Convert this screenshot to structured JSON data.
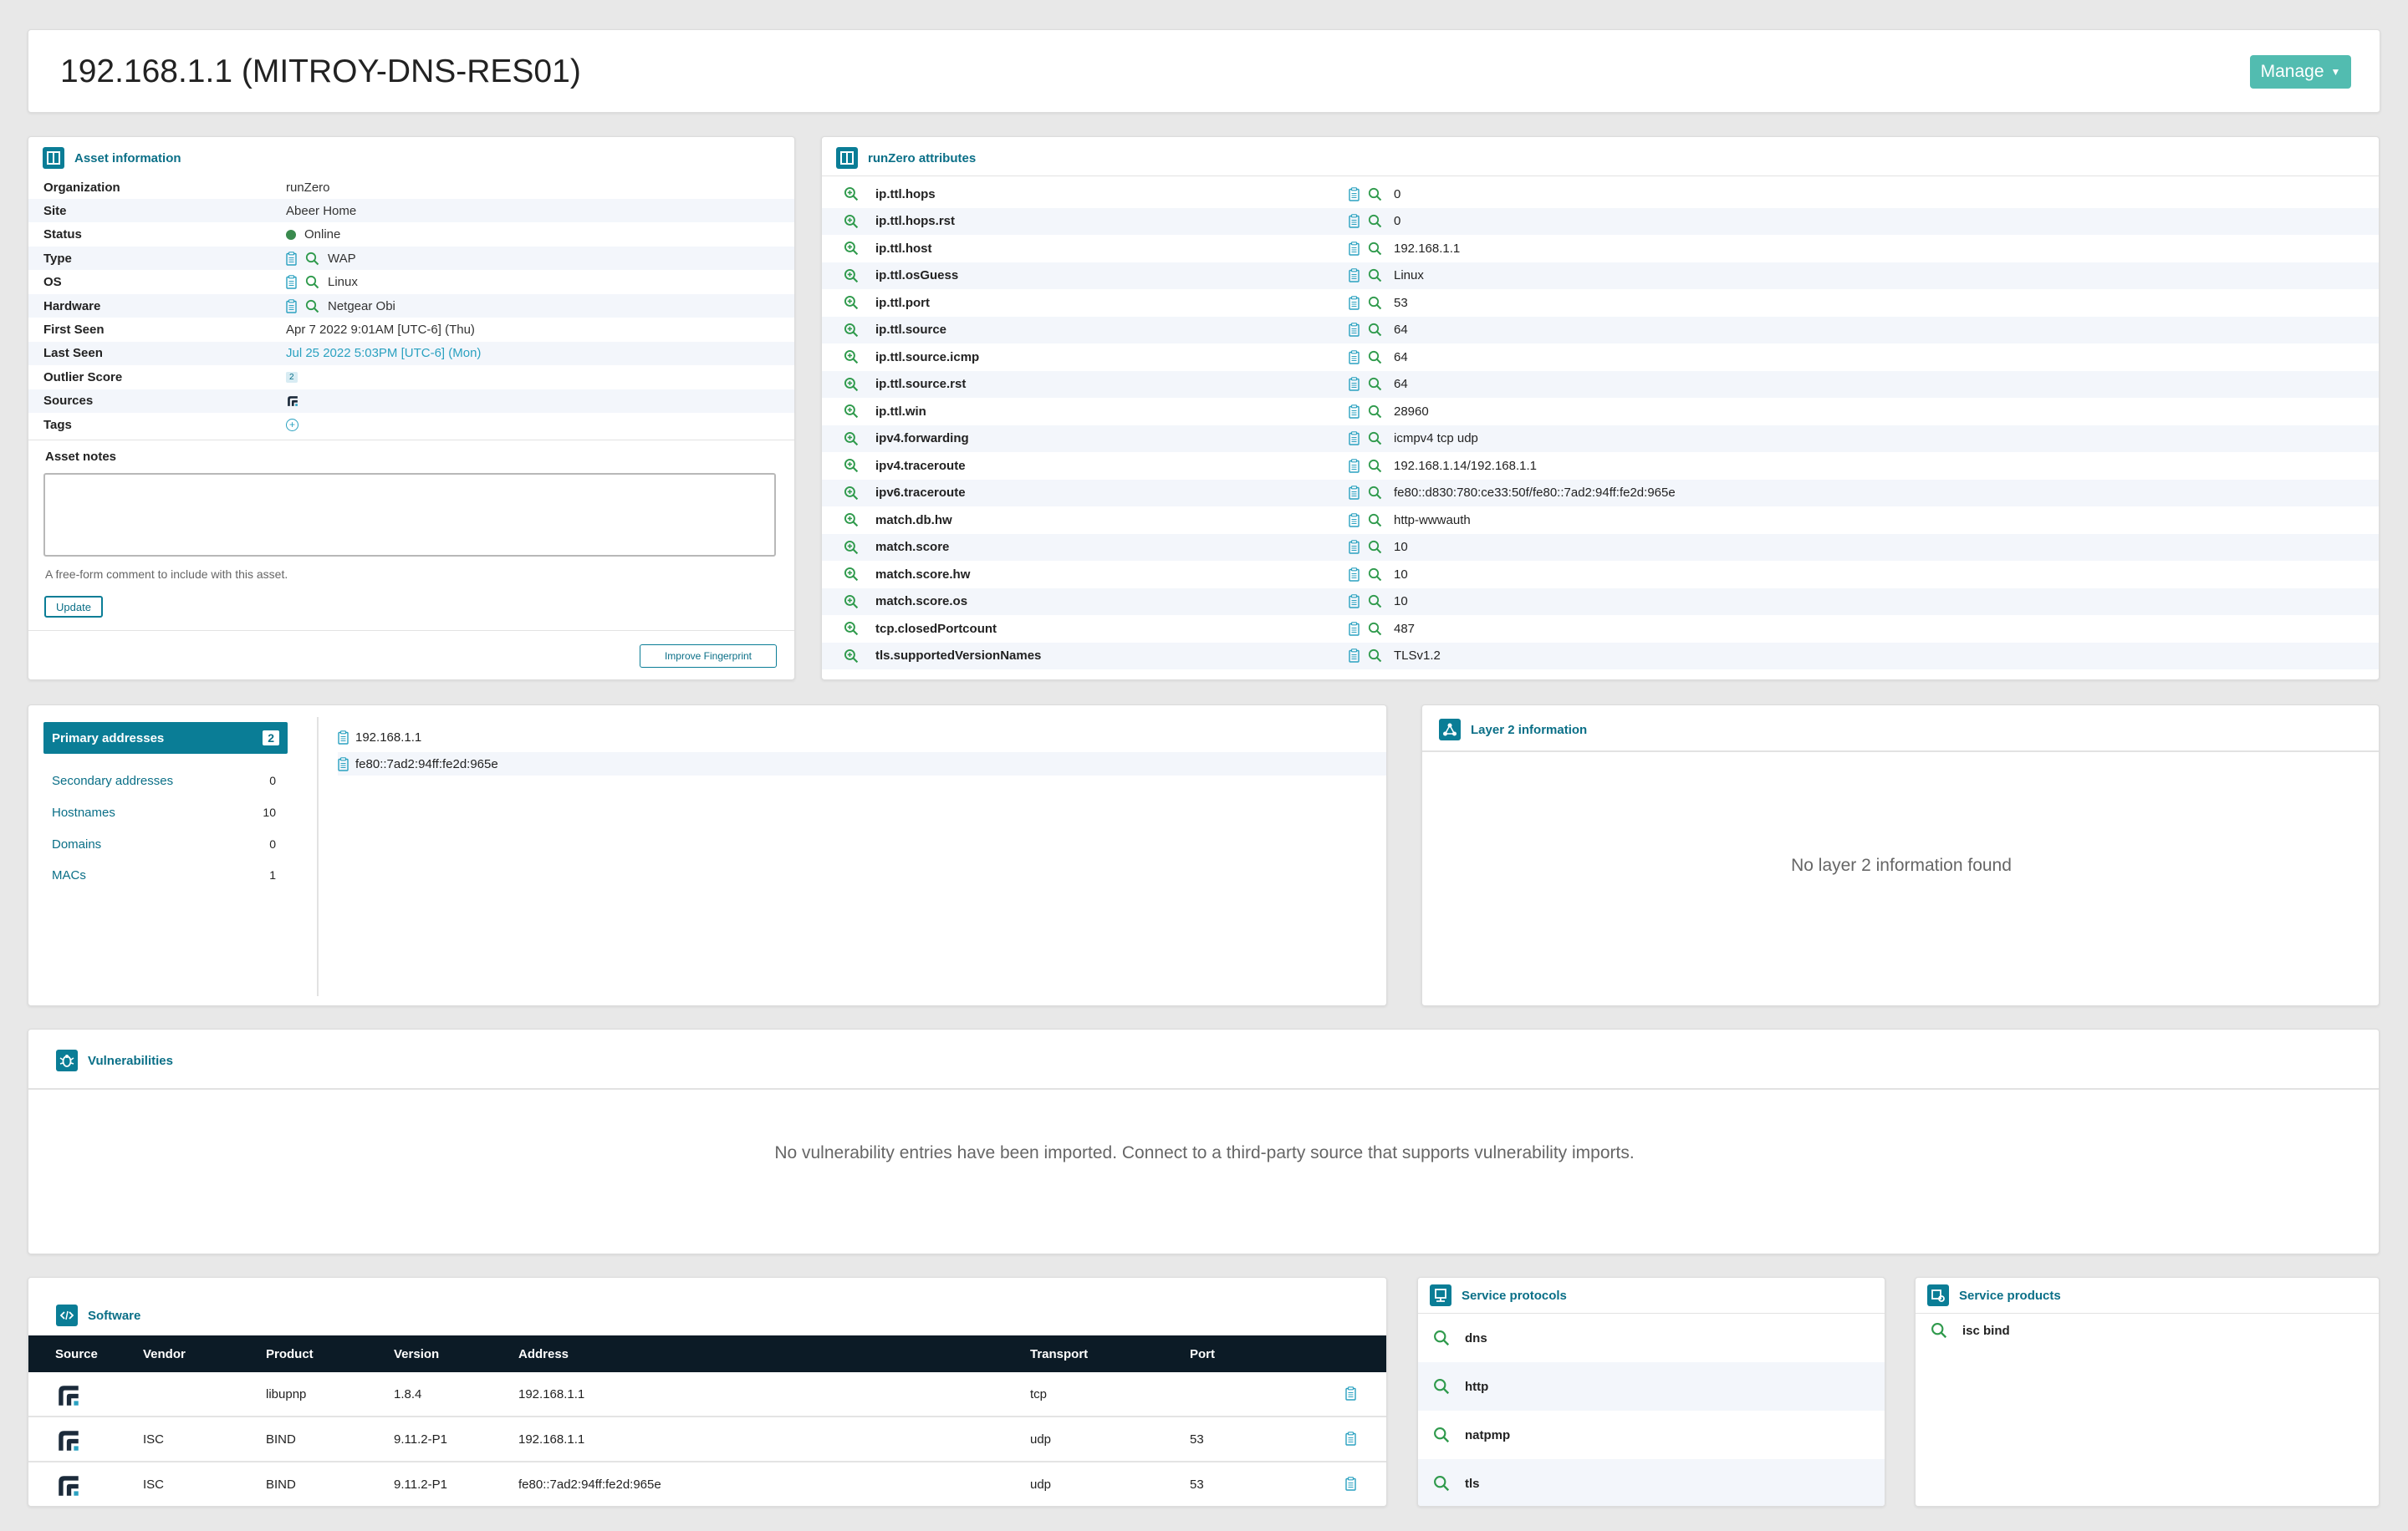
{
  "header": {
    "title": "192.168.1.1 (MITROY-DNS-RES01)",
    "manage_label": "Manage"
  },
  "asset_info": {
    "title": "Asset information",
    "rows": [
      {
        "key": "Organization",
        "value": "runZero"
      },
      {
        "key": "Site",
        "value": "Abeer Home"
      },
      {
        "key": "Status",
        "value": "Online"
      },
      {
        "key": "Type",
        "value": "WAP"
      },
      {
        "key": "OS",
        "value": "Linux"
      },
      {
        "key": "Hardware",
        "value": "Netgear Obi"
      },
      {
        "key": "First Seen",
        "value": "Apr 7 2022 9:01AM [UTC-6] (Thu)"
      },
      {
        "key": "Last Seen",
        "value": "Jul 25 2022 5:03PM [UTC-6] (Mon)"
      },
      {
        "key": "Outlier Score",
        "value": "2"
      },
      {
        "key": "Sources",
        "value": ""
      },
      {
        "key": "Tags",
        "value": ""
      }
    ],
    "notes_label": "Asset notes",
    "notes_value": "",
    "notes_help": "A free-form comment to include with this asset.",
    "update_label": "Update",
    "improve_label": "Improve Fingerprint",
    "status_color": "#3a8a4e",
    "link_color": "#2aa1c0"
  },
  "attributes": {
    "title": "runZero attributes",
    "rows": [
      {
        "key": "ip.ttl.hops",
        "value": "0"
      },
      {
        "key": "ip.ttl.hops.rst",
        "value": "0"
      },
      {
        "key": "ip.ttl.host",
        "value": "192.168.1.1"
      },
      {
        "key": "ip.ttl.osGuess",
        "value": "Linux"
      },
      {
        "key": "ip.ttl.port",
        "value": "53"
      },
      {
        "key": "ip.ttl.source",
        "value": "64"
      },
      {
        "key": "ip.ttl.source.icmp",
        "value": "64"
      },
      {
        "key": "ip.ttl.source.rst",
        "value": "64"
      },
      {
        "key": "ip.ttl.win",
        "value": "28960"
      },
      {
        "key": "ipv4.forwarding",
        "value": "icmpv4 tcp udp"
      },
      {
        "key": "ipv4.traceroute",
        "value": "192.168.1.14/192.168.1.1"
      },
      {
        "key": "ipv6.traceroute",
        "value": "fe80::d830:780:ce33:50f/fe80::7ad2:94ff:fe2d:965e"
      },
      {
        "key": "match.db.hw",
        "value": "http-wwwauth"
      },
      {
        "key": "match.score",
        "value": "10"
      },
      {
        "key": "match.score.hw",
        "value": "10"
      },
      {
        "key": "match.score.os",
        "value": "10"
      },
      {
        "key": "tcp.closedPortcount",
        "value": "487"
      },
      {
        "key": "tls.supportedVersionNames",
        "value": "TLSv1.2"
      }
    ]
  },
  "addresses": {
    "nav": [
      {
        "label": "Primary addresses",
        "count": "2"
      },
      {
        "label": "Secondary addresses",
        "count": "0"
      },
      {
        "label": "Hostnames",
        "count": "10"
      },
      {
        "label": "Domains",
        "count": "0"
      },
      {
        "label": "MACs",
        "count": "1"
      }
    ],
    "items": [
      "192.168.1.1",
      "fe80::7ad2:94ff:fe2d:965e"
    ]
  },
  "layer2": {
    "title": "Layer 2 information",
    "empty": "No layer 2 information found"
  },
  "vulns": {
    "title": "Vulnerabilities",
    "empty": "No vulnerability entries have been imported. Connect to a third-party source that supports vulnerability imports."
  },
  "software": {
    "title": "Software",
    "columns": [
      "Source",
      "Vendor",
      "Product",
      "Version",
      "Address",
      "Transport",
      "Port"
    ],
    "rows": [
      {
        "vendor": "",
        "product": "libupnp",
        "version": "1.8.4",
        "address": "192.168.1.1",
        "transport": "tcp",
        "port": ""
      },
      {
        "vendor": "ISC",
        "product": "BIND",
        "version": "9.11.2-P1",
        "address": "192.168.1.1",
        "transport": "udp",
        "port": "53"
      },
      {
        "vendor": "ISC",
        "product": "BIND",
        "version": "9.11.2-P1",
        "address": "fe80::7ad2:94ff:fe2d:965e",
        "transport": "udp",
        "port": "53"
      }
    ]
  },
  "service_protocols": {
    "title": "Service protocols",
    "items": [
      "dns",
      "http",
      "natpmp",
      "tls"
    ]
  },
  "service_products": {
    "title": "Service products",
    "items": [
      "isc bind"
    ]
  },
  "colors": {
    "accent": "#0a7d96",
    "manage": "#52bcb0",
    "search_green": "#2f9a4c",
    "table_header": "#0c1b26"
  }
}
